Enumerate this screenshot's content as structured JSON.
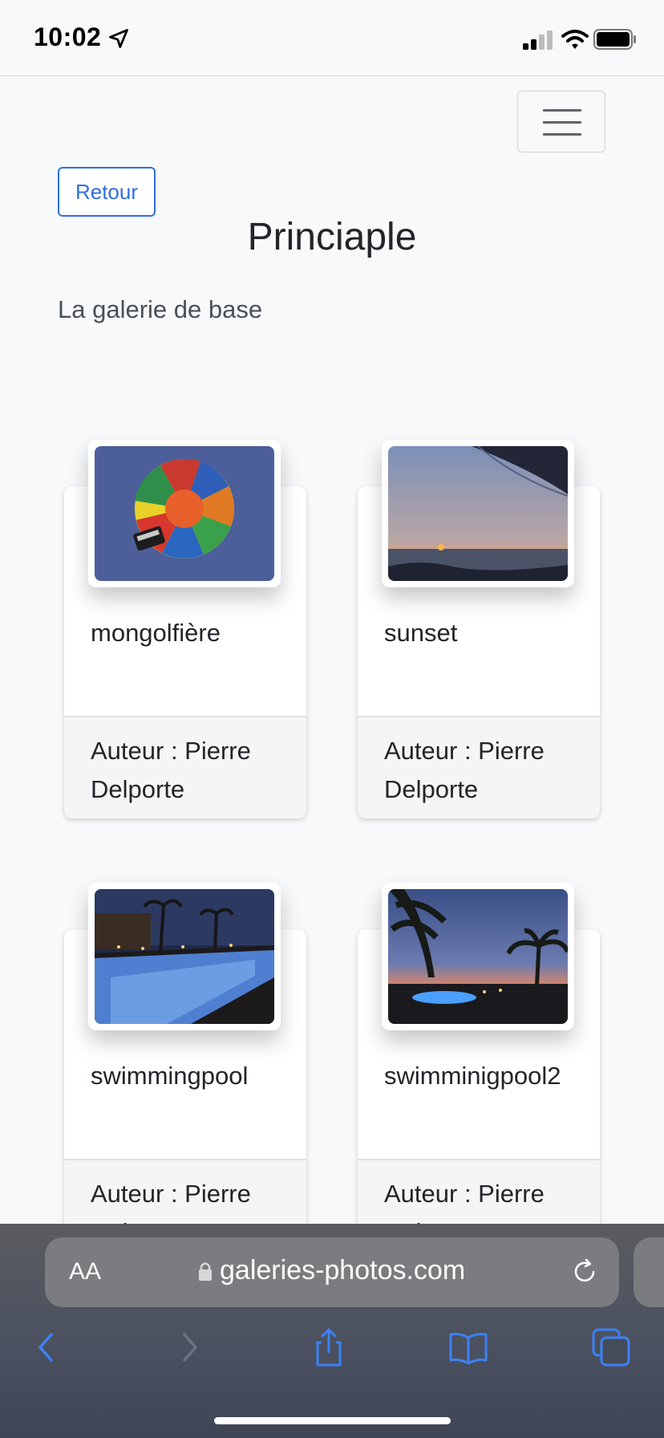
{
  "status_bar": {
    "time": "10:02"
  },
  "page": {
    "back_label": "Retour",
    "title": "Princiaple",
    "description": "La galerie de base"
  },
  "cards": [
    {
      "title": "mongolfière",
      "author": "Auteur : Pierre Delporte",
      "image": "hot-air-balloon-photo"
    },
    {
      "title": "sunset",
      "author": "Auteur : Pierre Delporte",
      "image": "sunset-sea-photo"
    },
    {
      "title": "swimmingpool",
      "author": "Auteur : Pierre Delporte",
      "image": "night-pool-photo"
    },
    {
      "title": "swimminigpool2",
      "author": "Auteur : Pierre Delporte",
      "image": "pool-palm-dusk-photo"
    }
  ],
  "browser": {
    "text_size_label": "AA",
    "url": "galeries-photos.com"
  },
  "colors": {
    "accent": "#2f6fde",
    "background": "#f8f9fa",
    "safari_icons": "#3b82f6"
  },
  "icons": [
    "location-arrow-icon",
    "signal-icon",
    "wifi-icon",
    "battery-icon",
    "hamburger-icon",
    "lock-icon",
    "reload-icon",
    "back-icon",
    "forward-icon",
    "share-icon",
    "bookmarks-icon",
    "tabs-icon"
  ]
}
